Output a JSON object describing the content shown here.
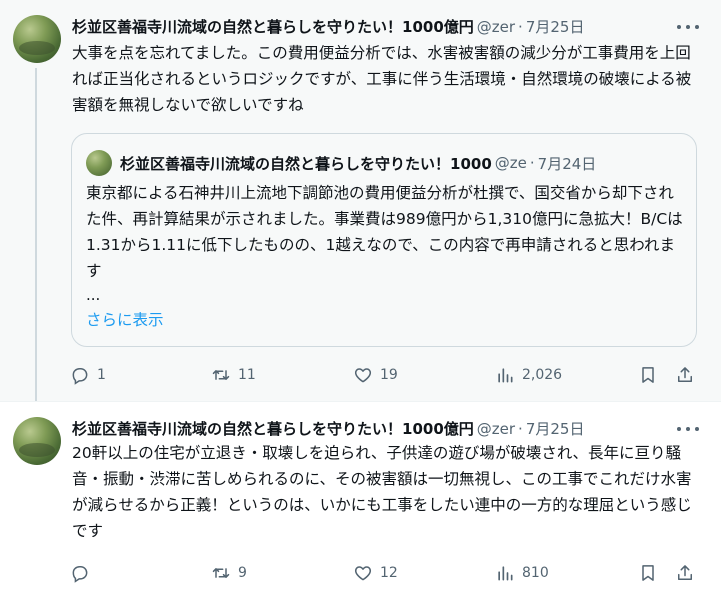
{
  "tweets": [
    {
      "name": "杉並区善福寺川流域の自然と暮らしを守りたい！1000億円",
      "handle": "@zer",
      "date": "7月25日",
      "text": "大事を点を忘れてました。この費用便益分析では、水害被害額の減少分が工事費用を上回れば正当化されるというロジックですが、工事に伴う生活環境・自然環境の破壊による被害額を無視しないで欲しいですね",
      "quote": {
        "name": "杉並区善福寺川流域の自然と暮らしを守りたい！1000",
        "handle": "@ze",
        "date": "7月24日",
        "text": "東京都による石神井川上流地下調節池の費用便益分析が杜撰で、国交省から却下された件、再計算結果が示されました。事業費は989億円から1,310億円に急拡大！B/Cは1.31から1.11に低下したものの、1越えなので、この内容で再申請されると思われます",
        "ellipsis": "...",
        "show_more": "さらに表示"
      },
      "stats": {
        "replies": "1",
        "retweets": "11",
        "likes": "19",
        "views": "2,026"
      }
    },
    {
      "name": "杉並区善福寺川流域の自然と暮らしを守りたい！1000億円",
      "handle": "@zer",
      "date": "7月25日",
      "text": "20軒以上の住宅が立退き・取壊しを迫られ、子供達の遊び場が破壊され、長年に亘り騒音・振動・渋滞に苦しめられるのに、その被害額は一切無視し、この工事でこれだけ水害が減らせるから正義！というのは、いかにも工事をしたい連中の一方的な理屈という感じです",
      "stats": {
        "replies": "",
        "retweets": "9",
        "likes": "12",
        "views": "810"
      }
    }
  ],
  "icons": {
    "reply": "reply-icon",
    "retweet": "retweet-icon",
    "like": "heart-icon",
    "views": "views-icon",
    "bookmark": "bookmark-icon",
    "share": "share-icon",
    "more": "more-icon"
  },
  "colors": {
    "link": "#1d9bf0",
    "muted": "#536471",
    "text": "#0f1419"
  }
}
